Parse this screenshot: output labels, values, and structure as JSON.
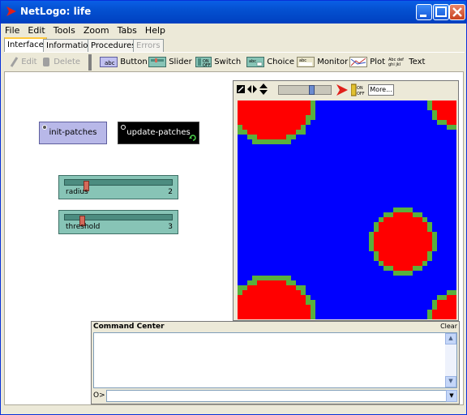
{
  "window": {
    "title": "NetLogo: life"
  },
  "menu": [
    "File",
    "Edit",
    "Tools",
    "Zoom",
    "Tabs",
    "Help"
  ],
  "tabs": [
    {
      "label": "Interface",
      "state": "active"
    },
    {
      "label": "Information",
      "state": "normal"
    },
    {
      "label": "Procedures",
      "state": "normal"
    },
    {
      "label": "Errors",
      "state": "disabled"
    }
  ],
  "toolbar": {
    "edit": "Edit",
    "delete": "Delete",
    "button": "Button",
    "slider": "Slider",
    "switch": "Switch",
    "choice": "Choice",
    "monitor": "Monitor",
    "plot": "Plot",
    "text": "Text"
  },
  "buttons": {
    "init": "init-patches",
    "update": "update-patches"
  },
  "sliders": [
    {
      "label": "radius",
      "value": "2",
      "fraction": 0.18
    },
    {
      "label": "threshold",
      "value": "3",
      "fraction": 0.14
    }
  ],
  "view": {
    "more_label": "More...",
    "speed_fraction": 0.65,
    "colors": {
      "background": "#0000FF",
      "cell": "#FF0000",
      "edge": "#59B03C"
    }
  },
  "command_center": {
    "title": "Command Center",
    "clear": "Clear",
    "prompt": "O>",
    "input_value": ""
  },
  "colors": {
    "title_bar": "#0450D0",
    "button_fill": "#B8B8E8",
    "forever_button_fill": "#000000",
    "slider_fill": "#87C4B6"
  }
}
